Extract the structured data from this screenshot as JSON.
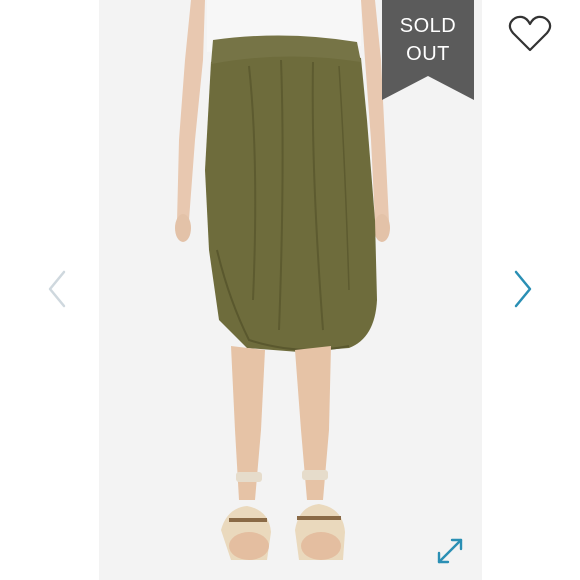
{
  "badge": {
    "line1": "SOLD",
    "line2": "OUT",
    "color": "#5b5b5b"
  },
  "product_image": {
    "description_icon": "product-photo",
    "skirt_color": "#6e6c3c",
    "top_color": "#f7f7f7",
    "background_color": "#f3f3f3"
  },
  "controls": {
    "favorite_icon": "heart-outline-icon",
    "prev_icon": "chevron-left-icon",
    "next_icon": "chevron-right-icon",
    "expand_icon": "expand-arrows-icon",
    "prev_color": "#cfd8de",
    "next_color": "#2a8fb4",
    "expand_color": "#2a8fb4"
  }
}
